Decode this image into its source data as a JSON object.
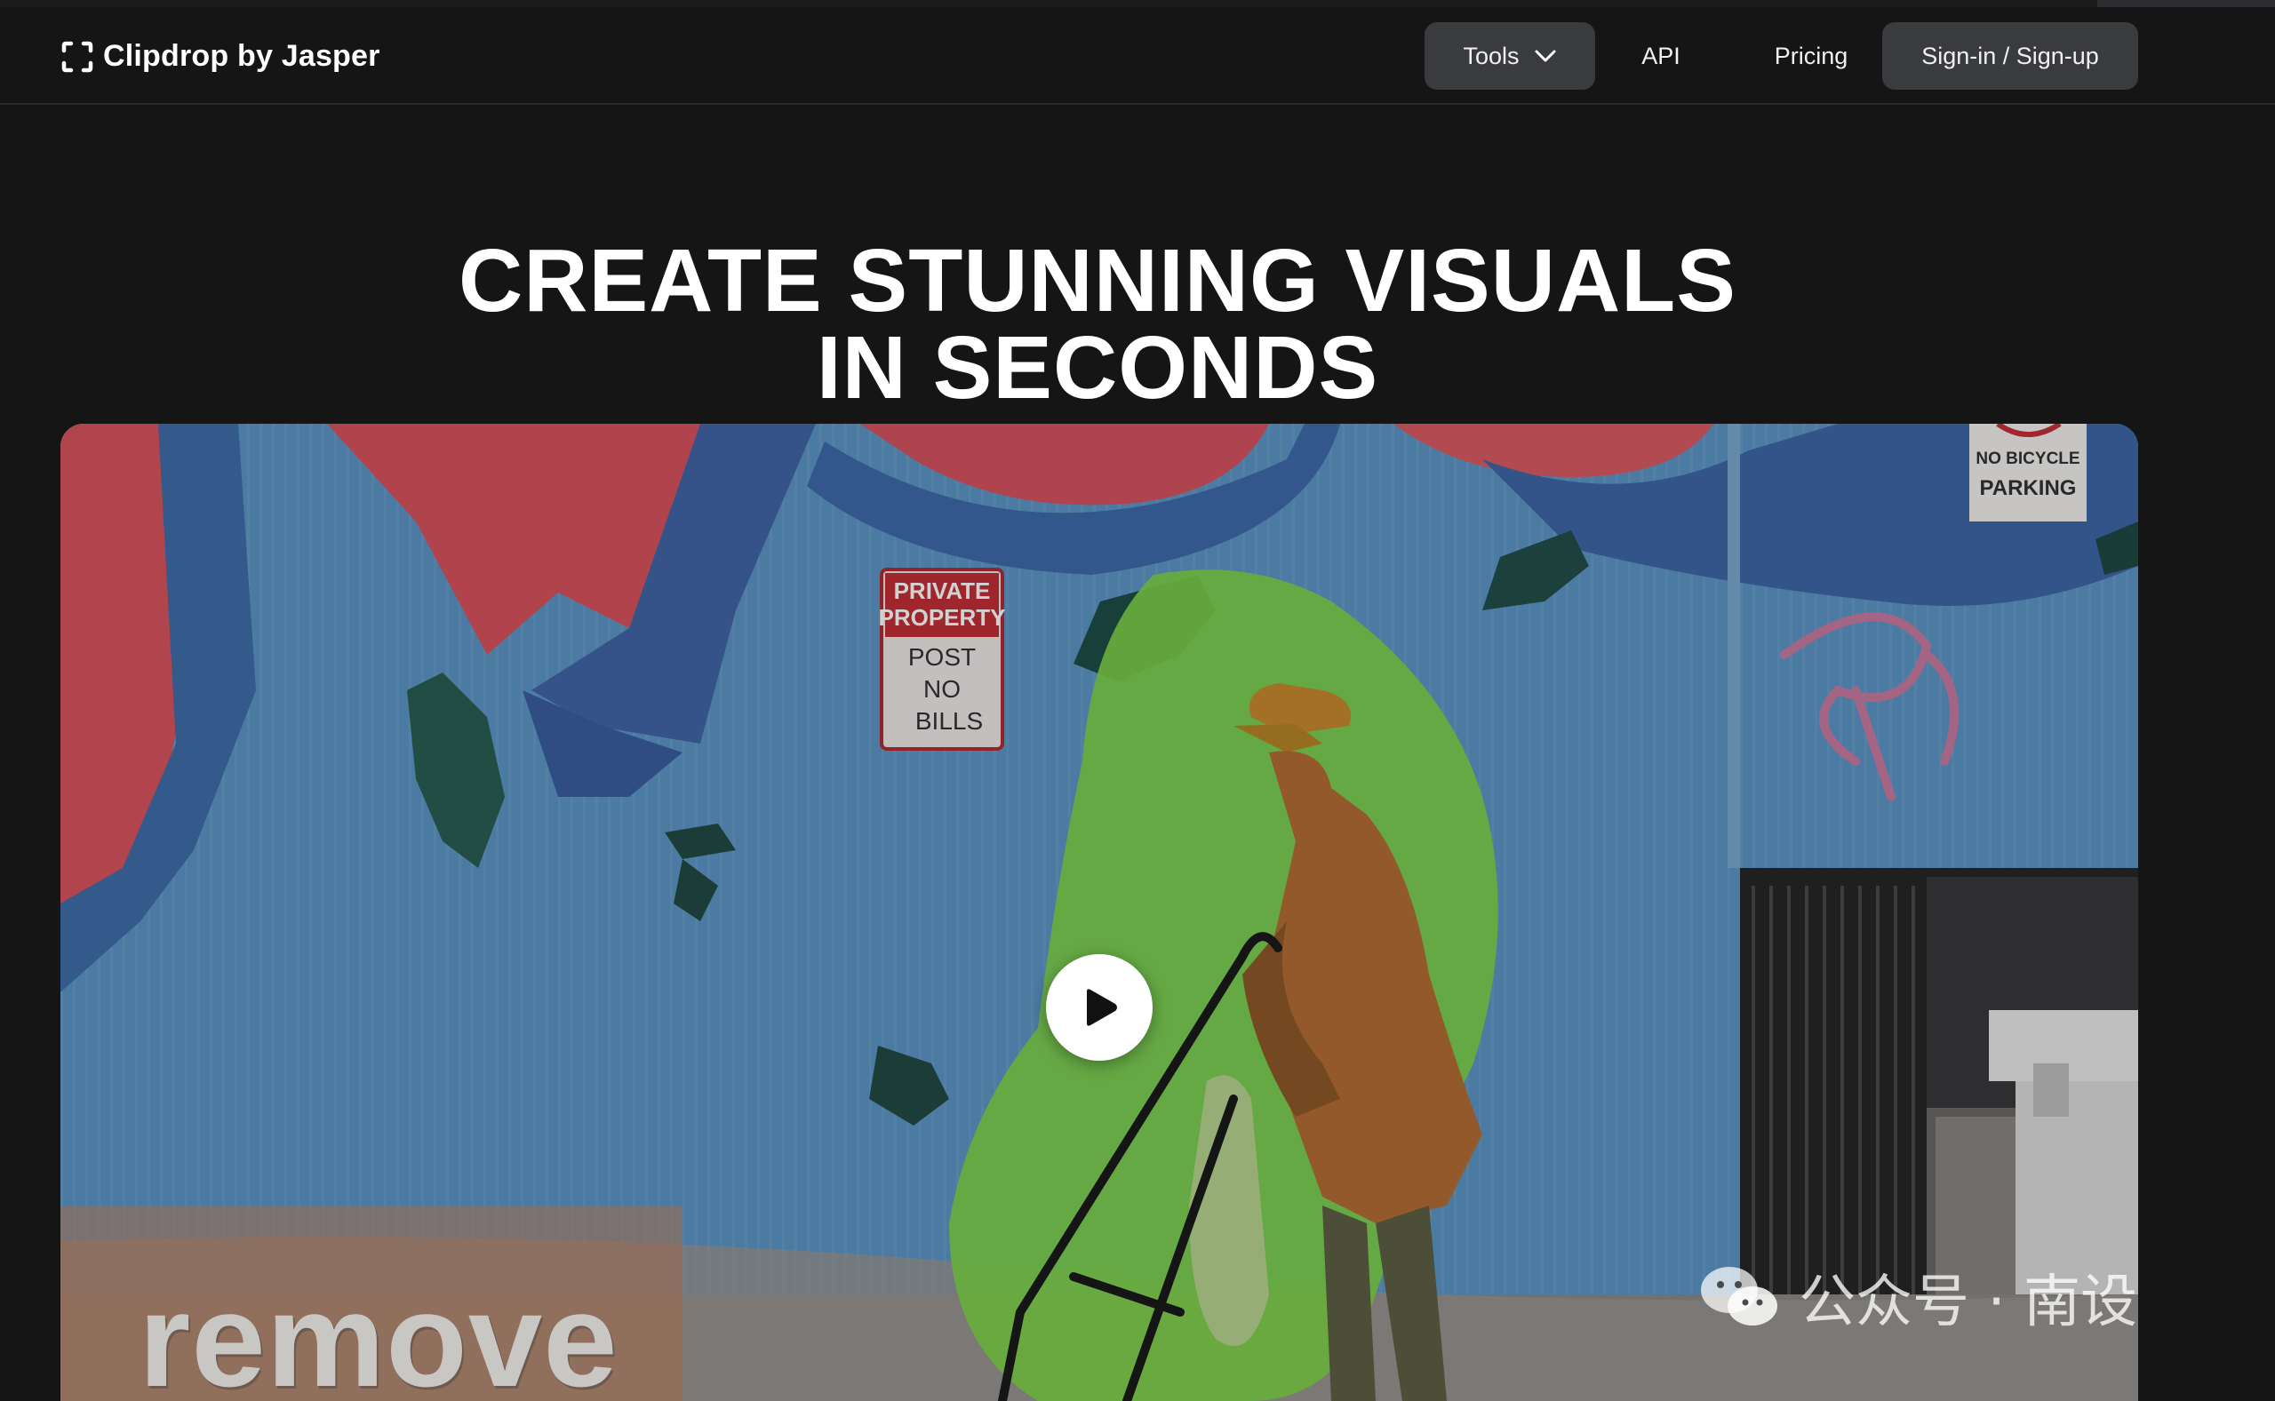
{
  "header": {
    "logo_text": "Clipdrop by Jasper",
    "nav": {
      "tools_label": "Tools",
      "api_label": "API",
      "pricing_label": "Pricing",
      "signin_label": "Sign-in / Sign-up"
    }
  },
  "hero": {
    "title_line1": "CREATE STUNNING VISUALS",
    "title_line2": "IN SECONDS"
  },
  "video": {
    "overlay_word": "remove",
    "signs": {
      "private_property": [
        "PRIVATE",
        "PROPERTY",
        "POST",
        "NO",
        "BILLS"
      ],
      "no_bicycle": [
        "NO BICYCLE",
        "PARKING"
      ]
    }
  },
  "watermark": {
    "text": "公众号 · 南设"
  },
  "colors": {
    "background": "#151516",
    "nav_button": "#3a3b3e",
    "highlight_mask": "#7fd44a"
  }
}
